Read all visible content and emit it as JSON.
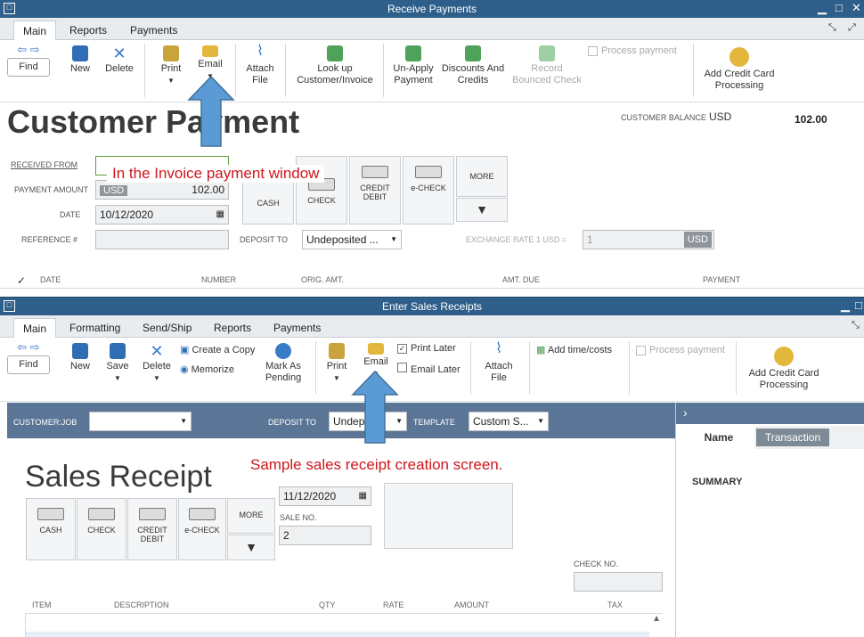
{
  "win1": {
    "title": "Receive Payments",
    "tabs": [
      "Main",
      "Reports",
      "Payments"
    ],
    "toolbar": {
      "find": "Find",
      "new": "New",
      "delete": "Delete",
      "print": "Print",
      "email": "Email",
      "attach": "Attach",
      "attach2": "File",
      "lookup": "Look up",
      "lookup2": "Customer/Invoice",
      "unapply": "Un-Apply",
      "unapply2": "Payment",
      "discounts": "Discounts And",
      "discounts2": "Credits",
      "record": "Record",
      "record2": "Bounced Check",
      "process_payment": "Process payment",
      "add_cc": "Add Credit Card",
      "add_cc2": "Processing"
    },
    "heading": "Customer Payment",
    "customer_balance_label": "CUSTOMER BALANCE",
    "currency": "USD",
    "customer_balance_value": "102.00",
    "received_from_label": "RECEIVED FROM",
    "payment_amount_label": "PAYMENT AMOUNT",
    "payment_amount_value": "102.00",
    "date_label": "DATE",
    "date_value": "10/12/2020",
    "reference_label": "REFERENCE #",
    "payment_methods": [
      "CASH",
      "CHECK",
      "CREDIT",
      "DEBIT",
      "e-CHECK",
      "MORE"
    ],
    "deposit_to_label": "DEPOSIT TO",
    "deposit_to_value": "Undeposited ...",
    "exchange_rate_label": "EXCHANGE RATE 1 USD =",
    "exchange_rate_value": "1",
    "columns": [
      "DATE",
      "NUMBER",
      "ORIG. AMT.",
      "AMT. DUE",
      "PAYMENT"
    ],
    "annotation": "In the Invoice payment window"
  },
  "win2": {
    "title": "Enter Sales Receipts",
    "tabs": [
      "Main",
      "Formatting",
      "Send/Ship",
      "Reports",
      "Payments"
    ],
    "toolbar": {
      "find": "Find",
      "new": "New",
      "save": "Save",
      "delete": "Delete",
      "create_copy": "Create a Copy",
      "memorize": "Memorize",
      "mark_as": "Mark As",
      "pending": "Pending",
      "print": "Print",
      "email": "Email",
      "print_later": "Print Later",
      "email_later": "Email Later",
      "attach": "Attach",
      "attach2": "File",
      "add_time": "Add time/costs",
      "process_payment": "Process payment",
      "add_cc": "Add Credit Card",
      "add_cc2": "Processing"
    },
    "customer_job_label": "CUSTOMER:JOB",
    "deposit_to_label": "DEPOSIT TO",
    "deposit_to_value": "Undep",
    "template_label": "TEMPLATE",
    "template_value": "Custom S...",
    "heading": "Sales Receipt",
    "payment_methods": [
      "CASH",
      "CHECK",
      "CREDIT",
      "DEBIT",
      "e-CHECK",
      "MORE"
    ],
    "date_value": "11/12/2020",
    "sale_no_label": "SALE NO.",
    "sale_no_value": "2",
    "check_no_label": "CHECK NO.",
    "columns": [
      "ITEM",
      "DESCRIPTION",
      "QTY",
      "RATE",
      "AMOUNT",
      "TAX"
    ],
    "side_tabs": [
      "Name",
      "Transaction"
    ],
    "summary_label": "SUMMARY",
    "annotation": "Sample sales receipt creation screen."
  }
}
